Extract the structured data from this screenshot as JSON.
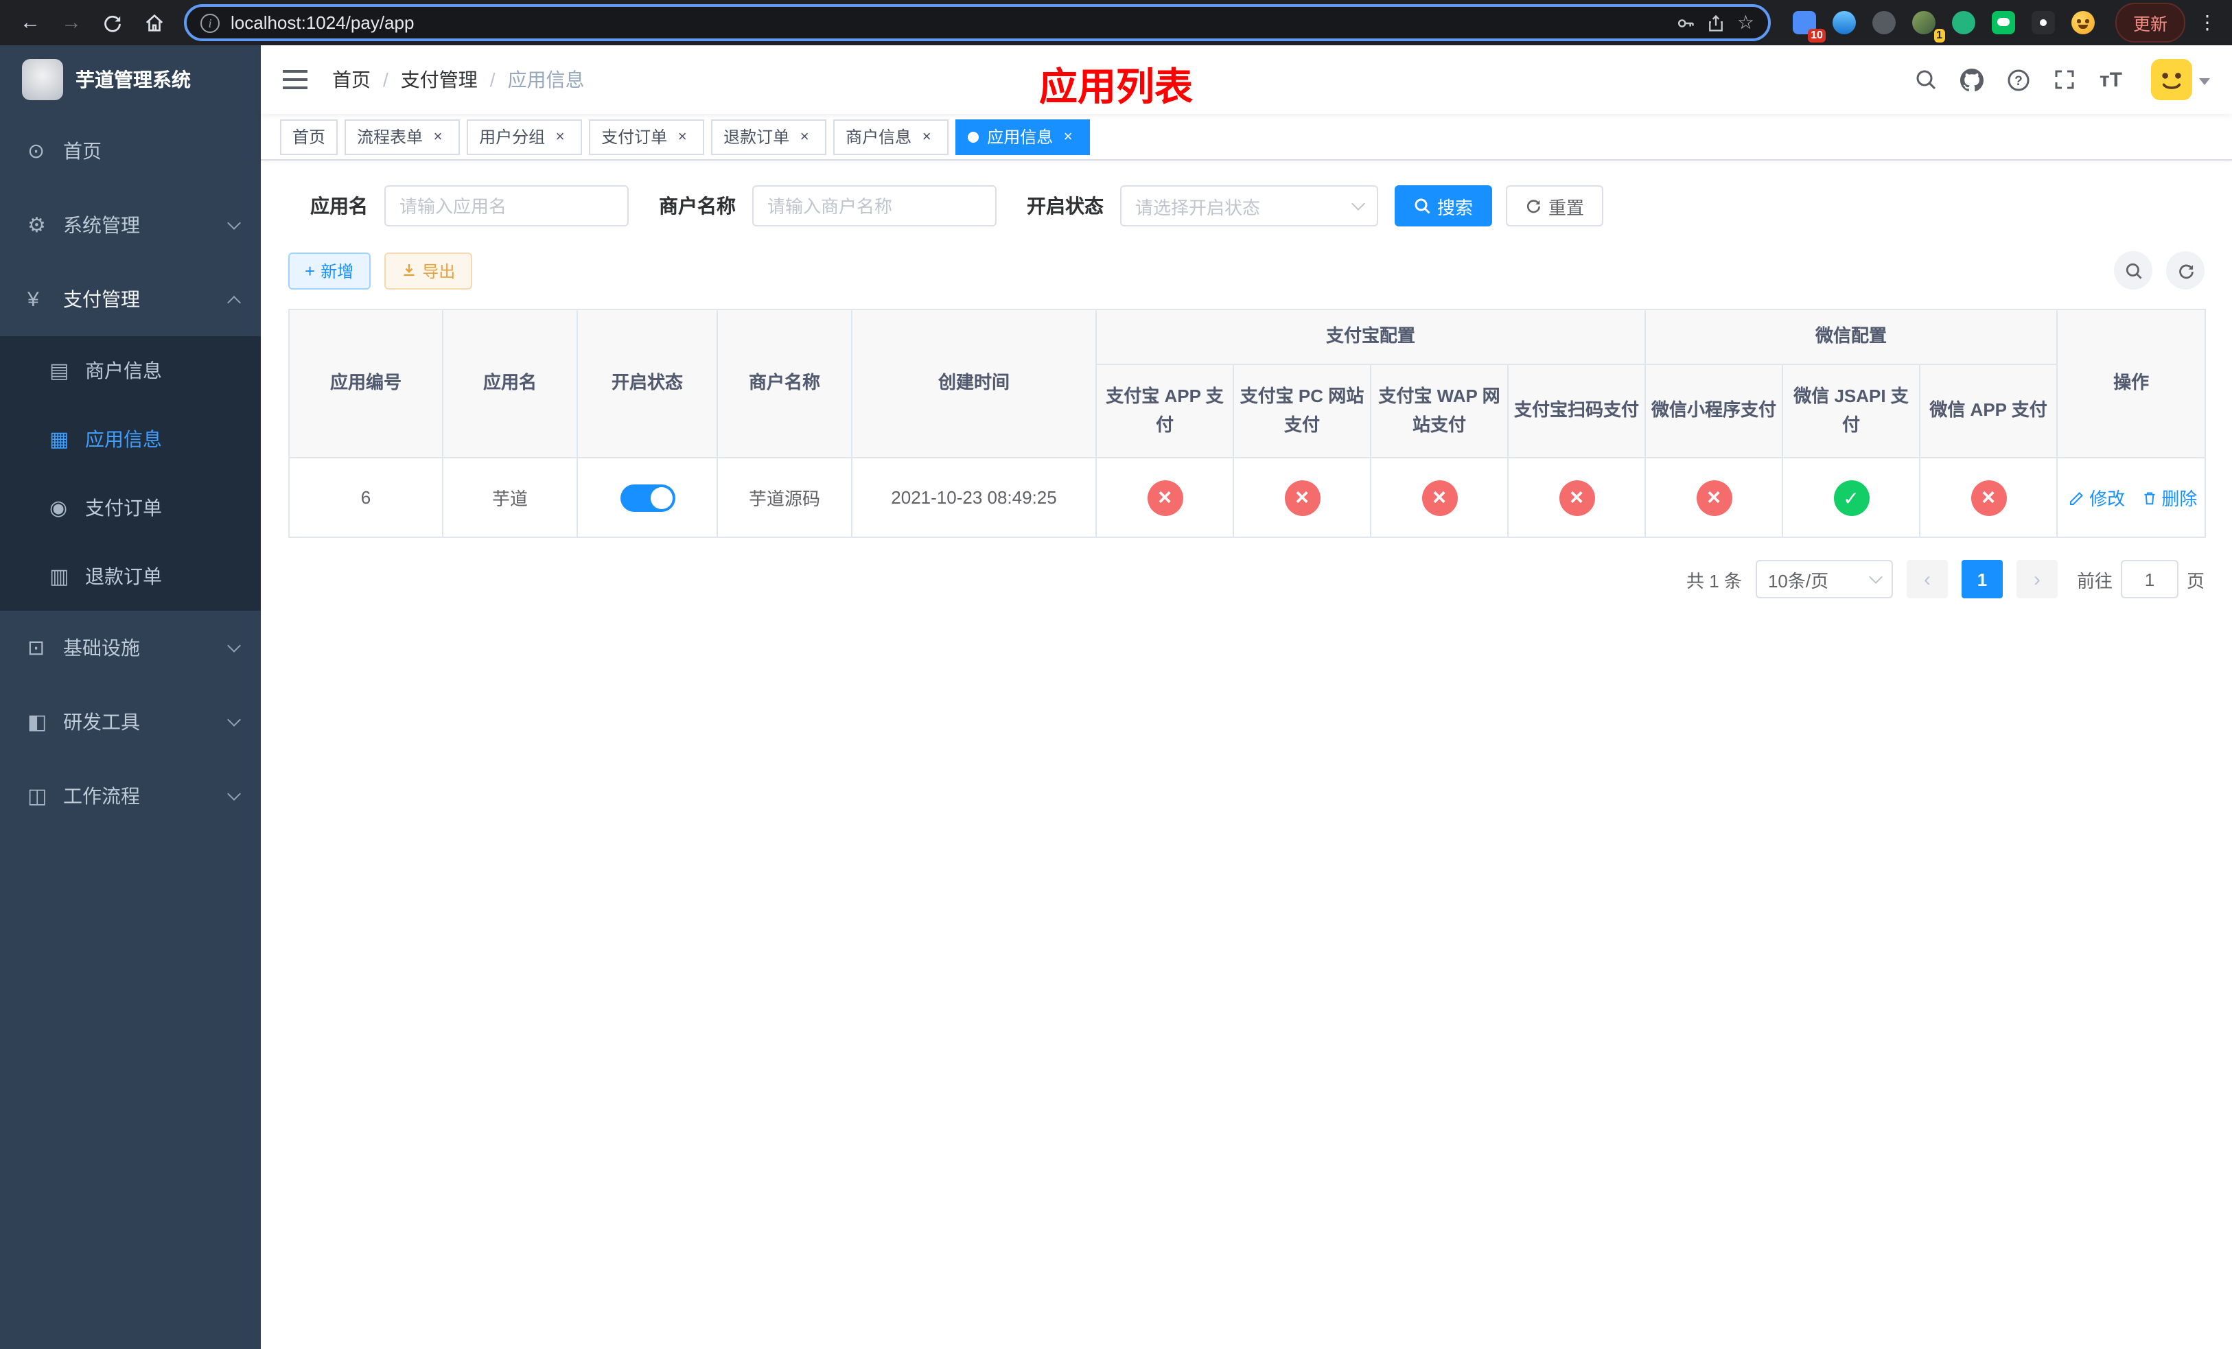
{
  "browser": {
    "url": "localhost:1024/pay/app",
    "update_label": "更新",
    "extensions_badge_count": "10",
    "avatar_badge_count": "1"
  },
  "sidebar": {
    "title": "芋道管理系统",
    "items": [
      {
        "label": "首页"
      },
      {
        "label": "系统管理"
      },
      {
        "label": "支付管理"
      },
      {
        "label": "商户信息"
      },
      {
        "label": "应用信息"
      },
      {
        "label": "支付订单"
      },
      {
        "label": "退款订单"
      },
      {
        "label": "基础设施"
      },
      {
        "label": "研发工具"
      },
      {
        "label": "工作流程"
      }
    ]
  },
  "header": {
    "breadcrumb": [
      {
        "label": "首页"
      },
      {
        "label": "支付管理"
      },
      {
        "label": "应用信息"
      }
    ],
    "page_title": "应用列表"
  },
  "tabs": {
    "items": [
      {
        "label": "首页",
        "closable": false,
        "active": false
      },
      {
        "label": "流程表单",
        "closable": true,
        "active": false
      },
      {
        "label": "用户分组",
        "closable": true,
        "active": false
      },
      {
        "label": "支付订单",
        "closable": true,
        "active": false
      },
      {
        "label": "退款订单",
        "closable": true,
        "active": false
      },
      {
        "label": "商户信息",
        "closable": true,
        "active": false
      },
      {
        "label": "应用信息",
        "closable": true,
        "active": true
      }
    ]
  },
  "filters": {
    "app_name_label": "应用名",
    "app_name_placeholder": "请输入应用名",
    "merchant_label": "商户名称",
    "merchant_placeholder": "请输入商户名称",
    "status_label": "开启状态",
    "status_placeholder": "请选择开启状态",
    "search_label": "搜索",
    "reset_label": "重置"
  },
  "toolbar": {
    "add_label": "新增",
    "export_label": "导出"
  },
  "table": {
    "headers": {
      "app_id": "应用编号",
      "app_name": "应用名",
      "status": "开启状态",
      "merchant": "商户名称",
      "created": "创建时间",
      "alipay_group": "支付宝配置",
      "wechat_group": "微信配置",
      "alipay_app": "支付宝 APP 支付",
      "alipay_pc": "支付宝 PC 网站支付",
      "alipay_wap": "支付宝 WAP 网站支付",
      "alipay_qr": "支付宝扫码支付",
      "wechat_mini": "微信小程序支付",
      "wechat_jsapi": "微信 JSAPI 支付",
      "wechat_app": "微信 APP 支付",
      "actions": "操作"
    },
    "row": {
      "app_id": "6",
      "app_name": "芋道",
      "status_on": true,
      "merchant": "芋道源码",
      "created": "2021-10-23 08:49:25",
      "configs": [
        false,
        false,
        false,
        false,
        false,
        true,
        false
      ],
      "edit_label": "修改",
      "delete_label": "删除"
    }
  },
  "pagination": {
    "total": "共 1 条",
    "page_size": "10条/页",
    "page": "1",
    "goto_prefix": "前往",
    "goto_value": "1",
    "goto_suffix": "页"
  },
  "colors": {
    "primary": "#1890ff",
    "sidebar_active": "#409eff",
    "success": "#13ce66",
    "danger": "#f56c6c",
    "title": "#ff0000"
  }
}
